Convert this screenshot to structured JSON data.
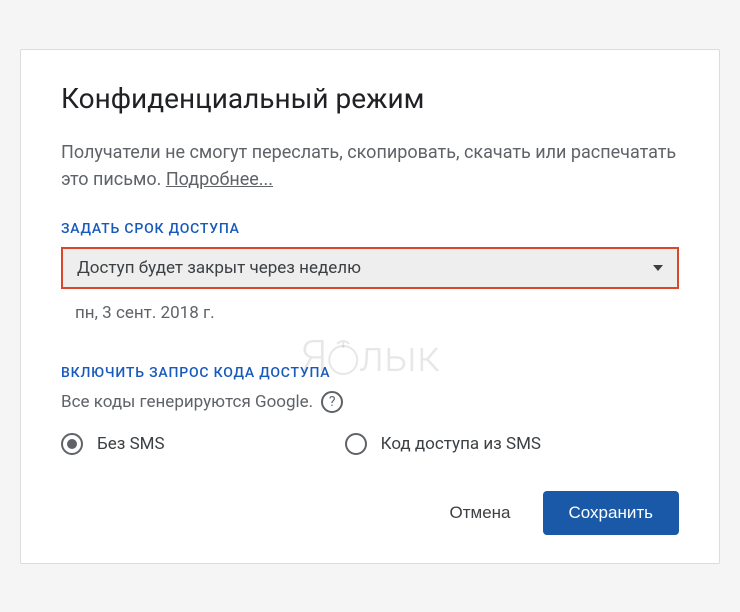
{
  "dialog": {
    "title": "Конфиденциальный режим",
    "description": "Получатели не смогут переслать, скопировать, скачать или распечатать это письмо. ",
    "learn_more": "Подробнее..."
  },
  "expiration": {
    "section_label": "ЗАДАТЬ СРОК ДОСТУПА",
    "selected": "Доступ будет закрыт через неделю",
    "date": "пн, 3 сент. 2018 г."
  },
  "passcode": {
    "section_label": "ВКЛЮЧИТЬ ЗАПРОС КОДА ДОСТУПА",
    "description": "Все коды генерируются Google.",
    "help_symbol": "?",
    "options": {
      "no_sms": "Без SMS",
      "sms": "Код доступа из SMS"
    }
  },
  "actions": {
    "cancel": "Отмена",
    "save": "Сохранить"
  },
  "watermark": {
    "left": "Я",
    "right": "лык"
  }
}
